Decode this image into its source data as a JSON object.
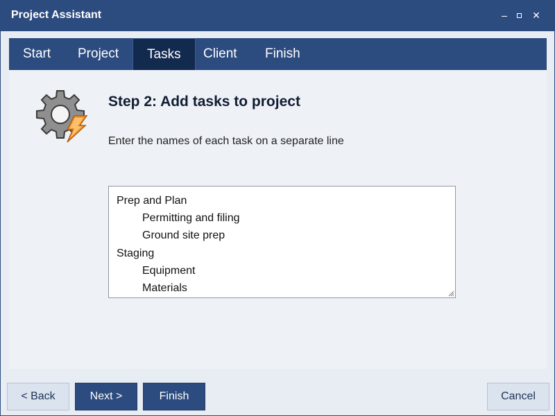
{
  "window": {
    "title": "Project Assistant",
    "controls": {
      "minimize": "minimize",
      "maximize": "maximize",
      "close": "✕"
    }
  },
  "tabs": [
    {
      "label": "Start",
      "active": false
    },
    {
      "label": "Project",
      "active": false
    },
    {
      "label": "Tasks",
      "active": true
    },
    {
      "label": "Client",
      "active": false
    },
    {
      "label": "Finish",
      "active": false
    }
  ],
  "content": {
    "icon": "gear-lightning-icon",
    "step_title": "Step 2: Add tasks to project",
    "instruction": "Enter the names of each task on a separate line",
    "tasks": [
      {
        "text": "Prep and Plan",
        "indent": 0
      },
      {
        "text": "Permitting and filing",
        "indent": 1
      },
      {
        "text": "Ground site prep",
        "indent": 1
      },
      {
        "text": "Staging",
        "indent": 0
      },
      {
        "text": "Equipment",
        "indent": 1
      },
      {
        "text": "Materials",
        "indent": 1
      }
    ]
  },
  "footer": {
    "back_label": "< Back",
    "next_label": "Next >",
    "finish_label": "Finish",
    "cancel_label": "Cancel"
  },
  "colors": {
    "primary": "#2c4b7f",
    "active_tab": "#132a4f",
    "background": "#e8edf3",
    "accent_orange": "#f29a2e"
  }
}
